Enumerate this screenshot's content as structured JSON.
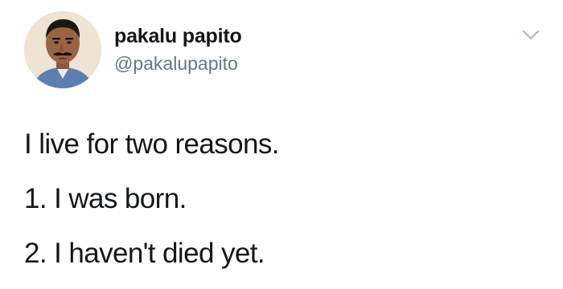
{
  "tweet": {
    "author": {
      "display_name": "pakalu papito",
      "handle": "@pakalupapito",
      "avatar_icon": "user-avatar"
    },
    "menu_icon": "chevron-down-icon",
    "lines": [
      "I live for two reasons.",
      "1. I was born.",
      "2. I haven't died yet."
    ]
  },
  "colors": {
    "text": "#14171a",
    "handle": "#657786",
    "chevron": "#aab8c2",
    "background": "#ffffff"
  }
}
